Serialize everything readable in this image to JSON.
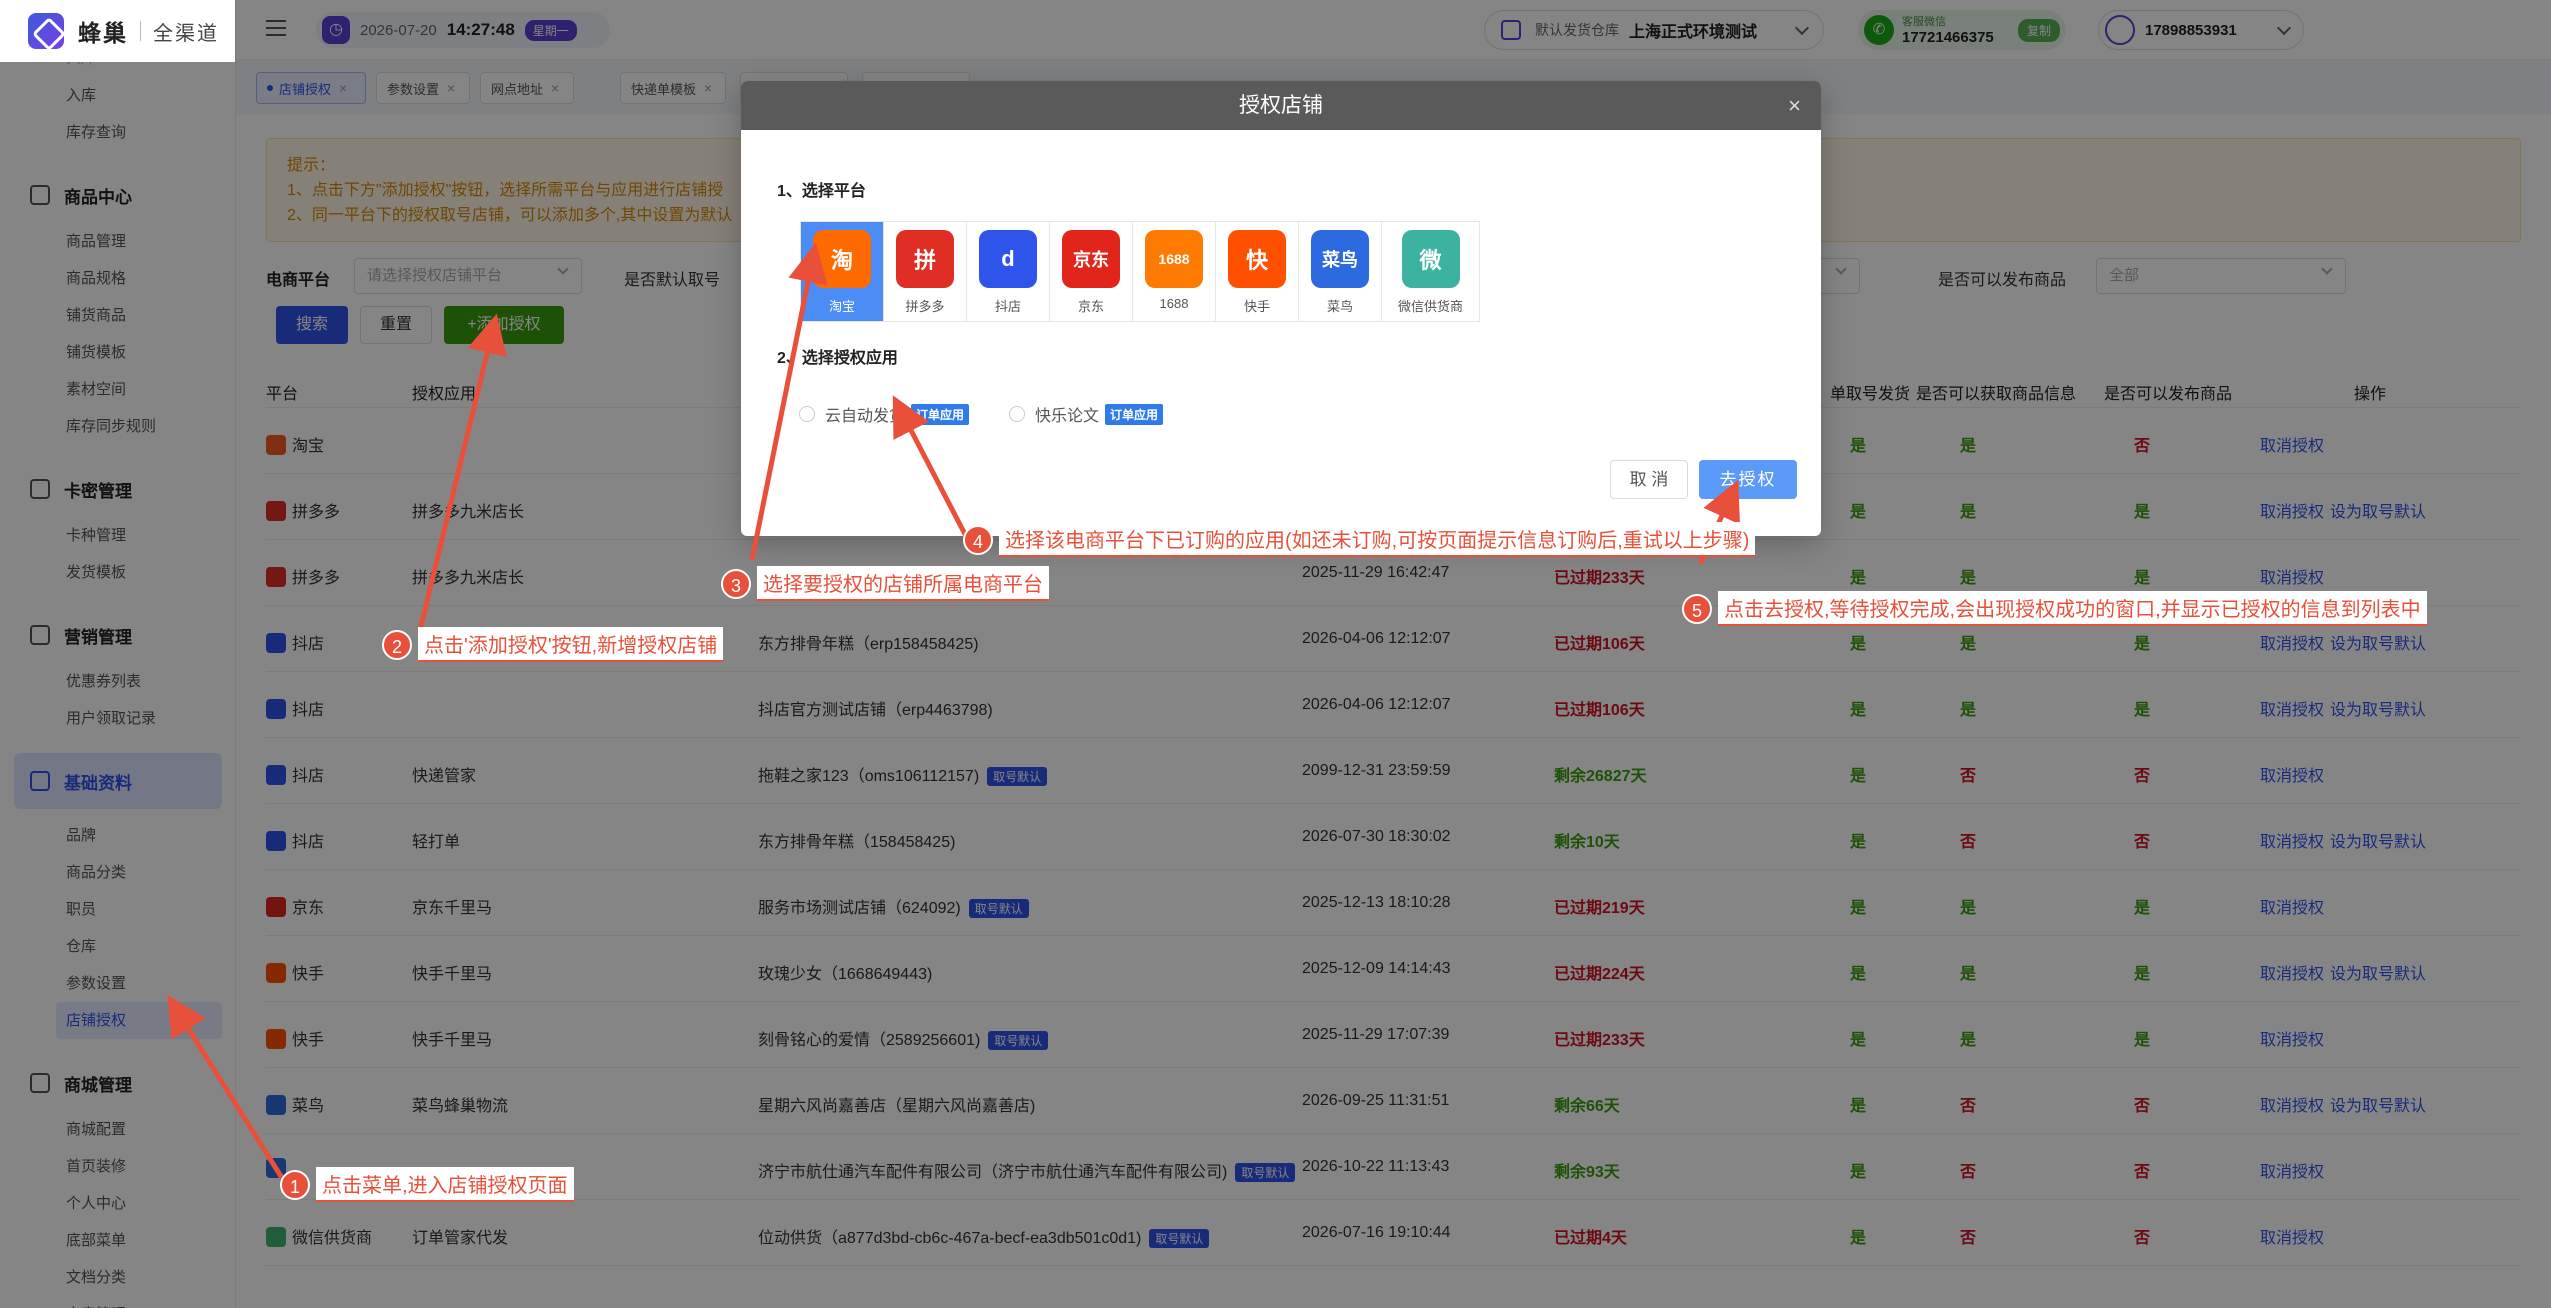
{
  "app": {
    "name": "蜂巢",
    "subtitle": "全渠道"
  },
  "sidebar": {
    "top_items": [
      "入库",
      "库存查询"
    ],
    "groups": [
      {
        "label": "商品中心",
        "items": [
          "商品管理",
          "商品规格",
          "铺货商品",
          "铺货模板",
          "素材空间",
          "库存同步规则"
        ]
      },
      {
        "label": "卡密管理",
        "items": [
          "卡种管理",
          "发货模板"
        ]
      },
      {
        "label": "营销管理",
        "items": [
          "优惠券列表",
          "用户领取记录"
        ]
      },
      {
        "label": "基础资料",
        "items": [
          "品牌",
          "商品分类",
          "职员",
          "仓库",
          "参数设置",
          "店铺授权"
        ]
      },
      {
        "label": "商城管理",
        "items": [
          "商城配置",
          "首页装修",
          "个人中心",
          "底部菜单",
          "文档分类",
          "文章管理"
        ]
      }
    ]
  },
  "header": {
    "date": "2026-07-20",
    "time": "14:27:48",
    "weekday": "星期一",
    "warehouse_label": "默认发货仓库",
    "warehouse_value": "上海正式环境测试",
    "service_label": "客服微信",
    "service_phone": "17721466375",
    "service_copy": "复制",
    "user_phone": "17898853931"
  },
  "tabs": [
    {
      "label": "店铺授权"
    },
    {
      "label": "参数设置"
    },
    {
      "label": "网点地址"
    },
    {
      "label": "快递单模板"
    },
    {
      "label": ""
    },
    {
      "label": ""
    }
  ],
  "tip": {
    "title": "提示：",
    "line1": "1、点击下方\"添加授权\"按钮，选择所需平台与应用进行店铺授",
    "line2": "2、同一平台下的授权取号店铺，可以添加多个,其中设置为默认"
  },
  "filters": {
    "platform_label": "电商平台",
    "platform_placeholder": "请选择授权店铺平台",
    "default_label": "是否默认取号",
    "publish_label": "是否可以发布商品",
    "publish_value": "全部"
  },
  "buttons": {
    "search": "搜索",
    "reset": "重置",
    "add": "+添加授权"
  },
  "table": {
    "headers": [
      "平台",
      "授权应用",
      "单取号发货",
      "是否可以获取商品信息",
      "是否可以发布商品",
      "操作"
    ],
    "rows": [
      {
        "platform": "淘宝",
        "color": "#f25a1d",
        "app": "",
        "shop": "",
        "shop_badge": "",
        "expire": "",
        "status": "",
        "status_good": true,
        "fetch": "是",
        "get_info": "是",
        "publish": "否",
        "ops": [
          "取消授权"
        ]
      },
      {
        "platform": "拼多多",
        "color": "#e02e24",
        "app": "拼多多九米店长",
        "shop": "",
        "shop_badge": "",
        "expire": "",
        "status": "",
        "status_good": true,
        "fetch": "是",
        "get_info": "是",
        "publish": "是",
        "ops": [
          "取消授权",
          "设为取号默认"
        ]
      },
      {
        "platform": "拼多多",
        "color": "#e02e24",
        "app": "拼多多九米店长",
        "shop": "",
        "shop_badge": "",
        "expire": "2025-11-29 16:42:47",
        "status": "已过期233天",
        "status_good": false,
        "fetch": "是",
        "get_info": "是",
        "publish": "是",
        "ops": [
          "取消授权"
        ]
      },
      {
        "platform": "抖店",
        "color": "#2f54eb",
        "app": "",
        "shop": "东方排骨年糕（erp158458425)",
        "shop_badge": "",
        "expire": "2026-04-06 12:12:07",
        "status": "已过期106天",
        "status_good": false,
        "fetch": "是",
        "get_info": "是",
        "publish": "是",
        "ops": [
          "取消授权",
          "设为取号默认"
        ]
      },
      {
        "platform": "抖店",
        "color": "#2f54eb",
        "app": "",
        "shop": "抖店官方测试店铺（erp4463798)",
        "shop_badge": "",
        "expire": "2026-04-06 12:12:07",
        "status": "已过期106天",
        "status_good": false,
        "fetch": "是",
        "get_info": "是",
        "publish": "是",
        "ops": [
          "取消授权",
          "设为取号默认"
        ]
      },
      {
        "platform": "抖店",
        "color": "#2f54eb",
        "app": "快递管家",
        "shop": "拖鞋之家123（oms106112157)",
        "shop_badge": "取号默认",
        "expire": "2099-12-31 23:59:59",
        "status": "剩余26827天",
        "status_good": true,
        "fetch": "是",
        "get_info": "否",
        "publish": "否",
        "ops": [
          "取消授权"
        ]
      },
      {
        "platform": "抖店",
        "color": "#2f54eb",
        "app": "轻打单",
        "shop": "东方排骨年糕（158458425)",
        "shop_badge": "",
        "expire": "2026-07-30 18:30:02",
        "status": "剩余10天",
        "status_good": true,
        "fetch": "是",
        "get_info": "否",
        "publish": "否",
        "ops": [
          "取消授权",
          "设为取号默认"
        ]
      },
      {
        "platform": "京东",
        "color": "#e1251b",
        "app": "京东千里马",
        "shop": "服务市场测试店铺（624092)",
        "shop_badge": "取号默认",
        "expire": "2025-12-13 18:10:28",
        "status": "已过期219天",
        "status_good": false,
        "fetch": "是",
        "get_info": "是",
        "publish": "是",
        "ops": [
          "取消授权"
        ]
      },
      {
        "platform": "快手",
        "color": "#ff5000",
        "app": "快手千里马",
        "shop": "玫瑰少女（1668649443)",
        "shop_badge": "",
        "expire": "2025-12-09 14:14:43",
        "status": "已过期224天",
        "status_good": false,
        "fetch": "是",
        "get_info": "是",
        "publish": "是",
        "ops": [
          "取消授权",
          "设为取号默认"
        ]
      },
      {
        "platform": "快手",
        "color": "#ff5000",
        "app": "快手千里马",
        "shop": "刻骨铭心的爱情（2589256601)",
        "shop_badge": "取号默认",
        "expire": "2025-11-29 17:07:39",
        "status": "已过期233天",
        "status_good": false,
        "fetch": "是",
        "get_info": "是",
        "publish": "是",
        "ops": [
          "取消授权"
        ]
      },
      {
        "platform": "菜鸟",
        "color": "#2d6ae0",
        "app": "菜鸟蜂巢物流",
        "shop": "星期六风尚嘉善店（星期六风尚嘉善店)",
        "shop_badge": "",
        "expire": "2026-09-25 11:31:51",
        "status": "剩余66天",
        "status_good": true,
        "fetch": "是",
        "get_info": "否",
        "publish": "否",
        "ops": [
          "取消授权",
          "设为取号默认"
        ]
      },
      {
        "platform": "",
        "color": "#2d6ae0",
        "app": "",
        "shop": "济宁市航仕通汽车配件有限公司（济宁市航仕通汽车配件有限公司)",
        "shop_badge": "取号默认",
        "expire": "2026-10-22 11:13:43",
        "status": "剩余93天",
        "status_good": true,
        "fetch": "是",
        "get_info": "否",
        "publish": "否",
        "ops": [
          "取消授权"
        ]
      },
      {
        "platform": "微信供货商",
        "color": "#3cb371",
        "app": "订单管家代发",
        "shop": "位动供货（a877d3bd-cb6c-467a-becf-ea3db501c0d1)",
        "shop_badge": "取号默认",
        "expire": "2026-07-16 19:10:44",
        "status": "已过期4天",
        "status_good": false,
        "fetch": "是",
        "get_info": "否",
        "publish": "否",
        "ops": [
          "取消授权"
        ]
      }
    ]
  },
  "modal": {
    "title": "授权店铺",
    "close": "×",
    "step1": "1、选择平台",
    "step2": "2、选择授权应用",
    "platforms": [
      {
        "name": "淘宝",
        "logo": "淘",
        "color": "#ff6a00",
        "selected": true
      },
      {
        "name": "拼多多",
        "logo": "拼",
        "color": "#e02e24",
        "selected": false
      },
      {
        "name": "抖店",
        "logo": "d",
        "color": "#2f54eb",
        "selected": false
      },
      {
        "name": "京东",
        "logo": "京东",
        "color": "#e1251b",
        "selected": false
      },
      {
        "name": "1688",
        "logo": "1688",
        "color": "#ff7a00",
        "selected": false
      },
      {
        "name": "快手",
        "logo": "快",
        "color": "#ff5000",
        "selected": false
      },
      {
        "name": "菜鸟",
        "logo": "菜鸟",
        "color": "#2d6ae0",
        "selected": false
      },
      {
        "name": "微信供货商",
        "logo": "微",
        "color": "#3cb3a0",
        "selected": false
      }
    ],
    "apps": [
      {
        "name": "云自动发货",
        "badge": "订单应用"
      },
      {
        "name": "快乐论文",
        "badge": "订单应用"
      }
    ],
    "cancel": "取 消",
    "confirm": "去授权"
  },
  "annotations": [
    {
      "num": "1",
      "text": "点击菜单,进入店铺授权页面"
    },
    {
      "num": "2",
      "text": "点击'添加授权'按钮,新增授权店铺"
    },
    {
      "num": "3",
      "text": "选择要授权的店铺所属电商平台"
    },
    {
      "num": "4",
      "text": "选择该电商平台下已订购的应用(如还未订购,可按页面提示信息订购后,重试以上步骤)"
    },
    {
      "num": "5",
      "text": "点击去授权,等待授权完成,会出现授权成功的窗口,并显示已授权的信息到列表中"
    }
  ],
  "colors": {
    "accent": "#2f54eb",
    "annotation": "#e8503a",
    "success": "#389e0d",
    "danger": "#cf1322"
  }
}
